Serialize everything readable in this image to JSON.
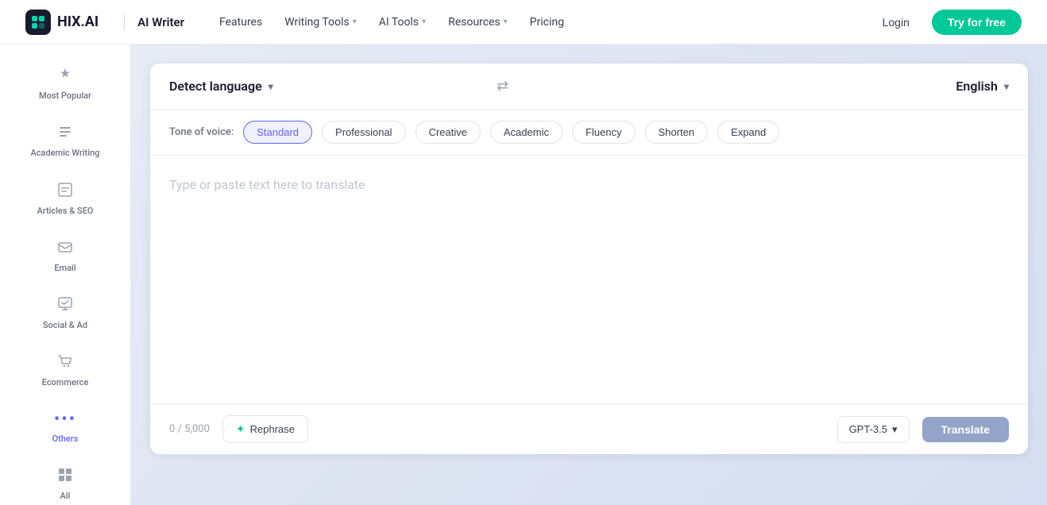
{
  "navbar": {
    "logo_text": "HIX.AI",
    "logo_subtitle": "AI Writer",
    "nav_links": [
      {
        "label": "Features",
        "has_dropdown": false
      },
      {
        "label": "Writing Tools",
        "has_dropdown": true
      },
      {
        "label": "AI Tools",
        "has_dropdown": true
      },
      {
        "label": "Resources",
        "has_dropdown": true
      },
      {
        "label": "Pricing",
        "has_dropdown": false
      }
    ],
    "login_label": "Login",
    "try_label": "Try for free"
  },
  "sidebar": {
    "items": [
      {
        "id": "most-popular",
        "icon": "⊞",
        "label": "Most Popular"
      },
      {
        "id": "academic-writing",
        "icon": "≡",
        "label": "Academic Writing"
      },
      {
        "id": "articles-seo",
        "icon": "▣",
        "label": "Articles & SEO"
      },
      {
        "id": "email",
        "icon": "✉",
        "label": "Email"
      },
      {
        "id": "social-ad",
        "icon": "⬒",
        "label": "Social & Ad"
      },
      {
        "id": "ecommerce",
        "icon": "🛒",
        "label": "Ecommerce"
      },
      {
        "id": "others",
        "icon": "···",
        "label": "Others"
      },
      {
        "id": "all",
        "icon": "⊞",
        "label": "All"
      }
    ]
  },
  "translator": {
    "source_lang": "Detect language",
    "target_lang": "English",
    "swap_icon": "⇄",
    "tone_label": "Tone of voice:",
    "tones": [
      {
        "id": "standard",
        "label": "Standard",
        "active": true
      },
      {
        "id": "professional",
        "label": "Professional",
        "active": false
      },
      {
        "id": "creative",
        "label": "Creative",
        "active": false
      },
      {
        "id": "academic",
        "label": "Academic",
        "active": false
      },
      {
        "id": "fluency",
        "label": "Fluency",
        "active": false
      },
      {
        "id": "shorten",
        "label": "Shorten",
        "active": false
      },
      {
        "id": "expand",
        "label": "Expand",
        "active": false
      }
    ],
    "placeholder": "Type or paste text here to translate",
    "char_count": "0 / 5,000",
    "rephrase_label": "Rephrase",
    "gpt_label": "GPT-3.5",
    "translate_label": "Translate"
  }
}
